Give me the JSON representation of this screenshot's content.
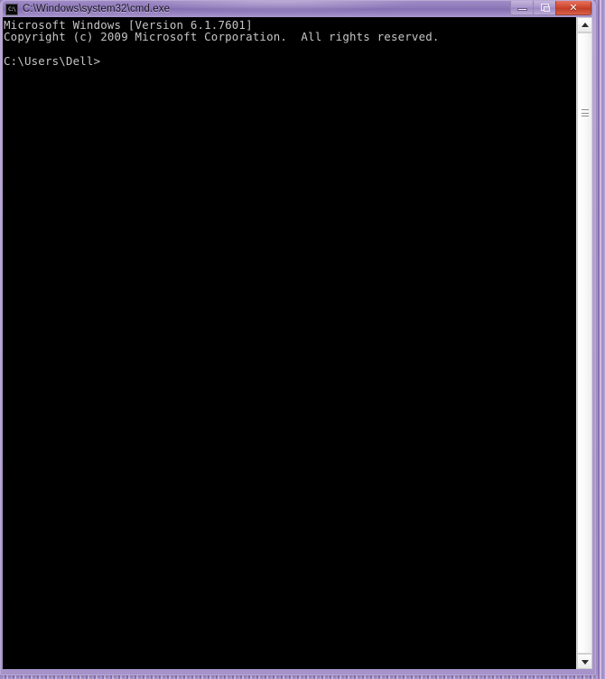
{
  "window": {
    "title": "C:\\Windows\\system32\\cmd.exe",
    "icon": "cmd-console-icon",
    "icon_text": "C:\\",
    "controls": {
      "minimize_label": "Minimize",
      "restore_label": "Restore",
      "close_label": "✕"
    },
    "colors": {
      "titlebar": "#8e79b9",
      "frame": "#a593c9",
      "close_button": "#cf4a33",
      "console_background": "#000000",
      "console_text": "#c6c6c6",
      "desktop": "#a58fc8"
    }
  },
  "console": {
    "lines": [
      "Microsoft Windows [Version 6.1.7601]",
      "Copyright (c) 2009 Microsoft Corporation.  All rights reserved.",
      "",
      "C:\\Users\\Dell>"
    ]
  },
  "scrollbar": {
    "up_arrow": "scroll-up-arrow",
    "down_arrow": "scroll-down-arrow",
    "thumb": "scroll-thumb"
  }
}
